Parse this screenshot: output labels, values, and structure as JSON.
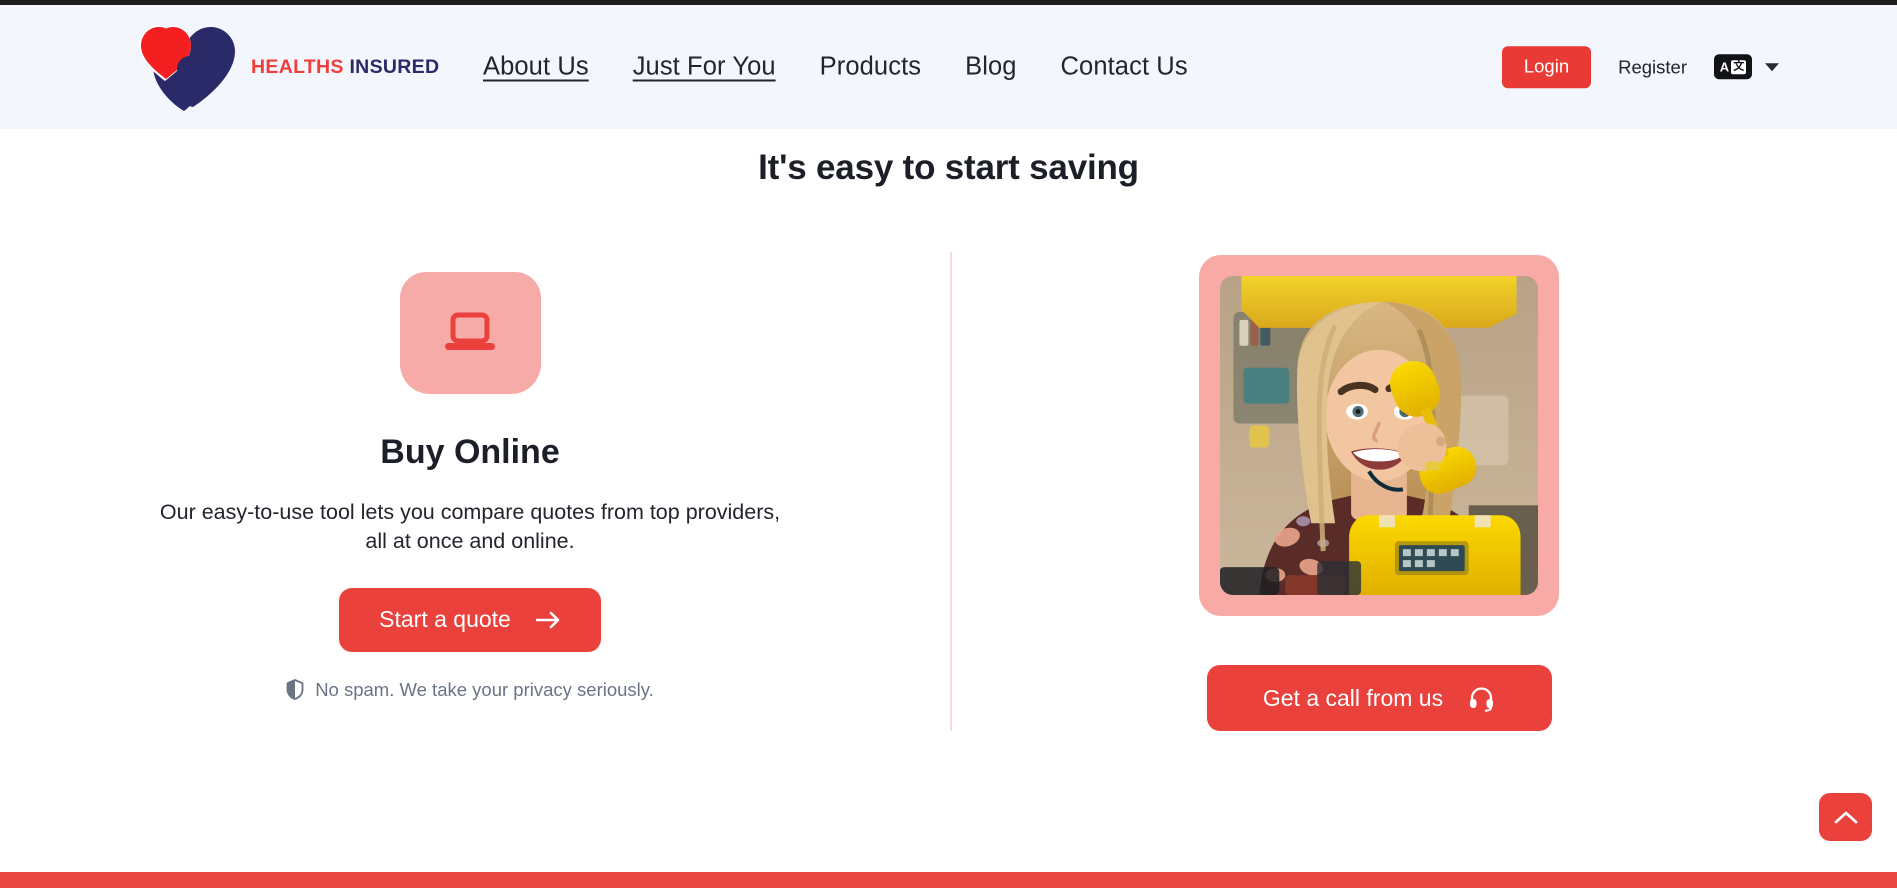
{
  "brand": {
    "name_first": "HEALTHS",
    "name_second": "INSURED",
    "logo_icon": "heart-person-logo"
  },
  "nav": {
    "items": [
      {
        "label": "About Us",
        "underlined": true
      },
      {
        "label": "Just For You",
        "underlined": true
      },
      {
        "label": "Products",
        "underlined": false
      },
      {
        "label": "Blog",
        "underlined": false
      },
      {
        "label": "Contact Us",
        "underlined": false
      }
    ]
  },
  "header_actions": {
    "login_label": "Login",
    "register_label": "Register",
    "language_badge_a": "A",
    "language_badge_cjk": "文",
    "language_icon": "translate-icon",
    "caret_icon": "chevron-down-icon"
  },
  "page": {
    "title": "It's easy to start saving"
  },
  "buy_online": {
    "icon": "laptop-icon",
    "title": "Buy Online",
    "body": "Our easy-to-use tool lets you compare quotes from top providers, all at once and online.",
    "cta_label": "Start a quote",
    "cta_icon": "arrow-right-icon",
    "privacy_icon": "shield-icon",
    "privacy_text": "No spam. We take your privacy seriously."
  },
  "call_card": {
    "photo_alt": "Smiling woman holding a yellow rotary telephone handset",
    "cta_label": "Get a call from us",
    "cta_icon": "headset-icon"
  },
  "scroll_top": {
    "icon": "chevron-up-icon"
  },
  "colors": {
    "accent_red": "#ea413c",
    "brand_navy": "#2b2a68",
    "brand_red": "#ef3e3b",
    "header_bg": "#f3f6fd",
    "pink_tile": "#f7aba8",
    "divider": "#fbdcdb"
  }
}
